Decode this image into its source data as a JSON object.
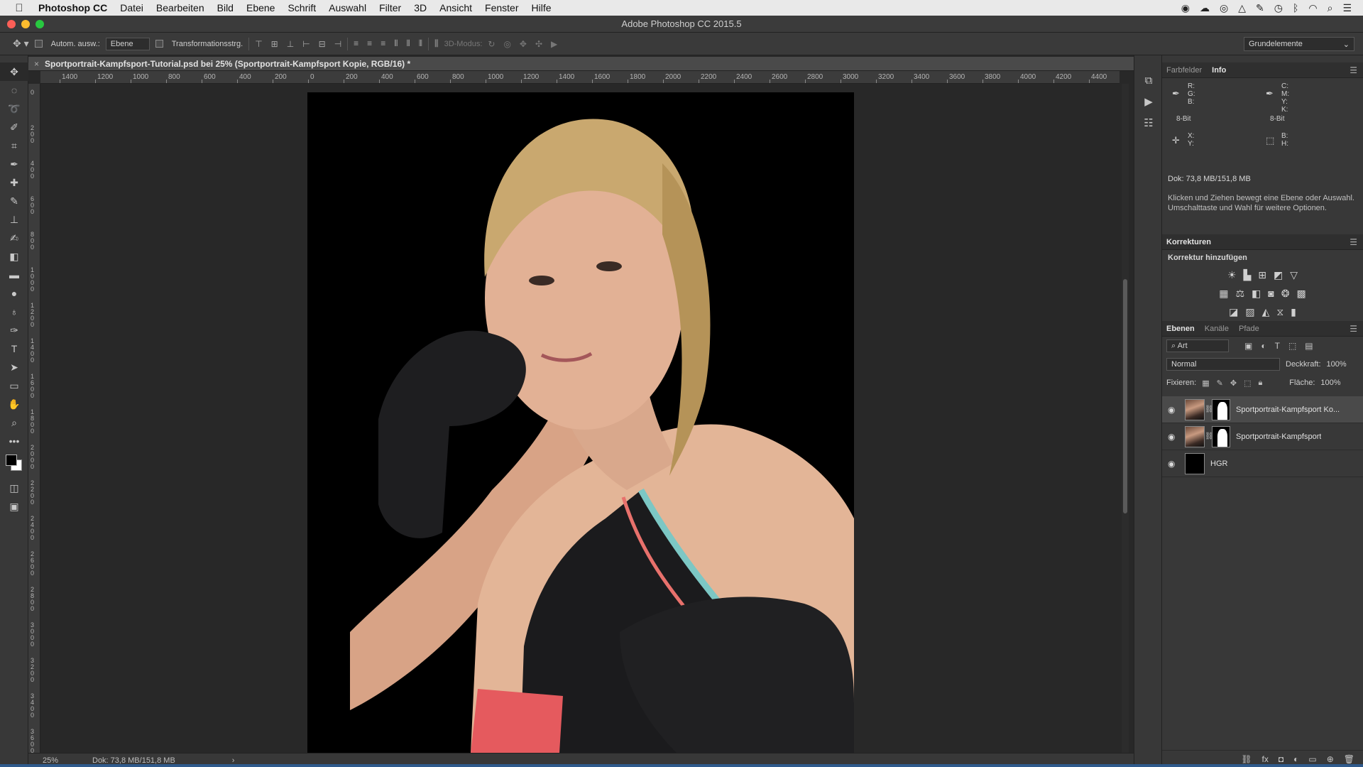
{
  "menubar": {
    "app_name": "Photoshop CC",
    "items": [
      "Datei",
      "Bearbeiten",
      "Bild",
      "Ebene",
      "Schrift",
      "Auswahl",
      "Filter",
      "3D",
      "Ansicht",
      "Fenster",
      "Hilfe"
    ]
  },
  "window": {
    "title": "Adobe Photoshop CC 2015.5"
  },
  "options_bar": {
    "auto_select_label": "Autom. ausw.:",
    "auto_select_target": "Ebene",
    "transform_controls_label": "Transformationsstrg.",
    "mode_3d_label": "3D-Modus:",
    "workspace": "Grundelemente"
  },
  "document": {
    "tab_title": "Sportportrait-Kampfsport-Tutorial.psd bei 25% (Sportportrait-Kampfsport Kopie, RGB/16) *",
    "ruler_h_labels": [
      "1400",
      "1200",
      "1000",
      "800",
      "600",
      "400",
      "200",
      "0",
      "200",
      "400",
      "600",
      "800",
      "1000",
      "1200",
      "1400",
      "1600",
      "1800",
      "2000",
      "2200",
      "2400",
      "2600",
      "2800",
      "3000",
      "3200",
      "3400",
      "3600",
      "3800",
      "4000",
      "4200",
      "4400"
    ],
    "ruler_v_labels": [
      "0",
      "200",
      "400",
      "600",
      "800",
      "1000",
      "1200",
      "1400",
      "1600",
      "1800",
      "2000",
      "2200",
      "2400",
      "2600",
      "2800",
      "3000",
      "3200",
      "3400",
      "3600"
    ]
  },
  "status_bar": {
    "zoom": "25%",
    "doc_size": "Dok: 73,8 MB/151,8 MB",
    "arrow": "›"
  },
  "info_panel": {
    "tabs": [
      "Farbfelder",
      "Info"
    ],
    "active_tab": "Info",
    "rgb_labels": "R:\nG:\nB:",
    "cmyk_labels": "C:\nM:\nY:\nK:",
    "bit_depth_left": "8-Bit",
    "bit_depth_right": "8-Bit",
    "xy_labels": "X:\nY:",
    "bh_labels": "B:\nH:",
    "doc_size": "Dok: 73,8 MB/151,8 MB",
    "hint": "Klicken und Ziehen bewegt eine Ebene oder Auswahl. Umschalttaste und Wahl für weitere Optionen."
  },
  "corrections_panel": {
    "title": "Korrekturen",
    "subtitle": "Korrektur hinzufügen"
  },
  "layers_panel": {
    "tabs": [
      "Ebenen",
      "Kanäle",
      "Pfade"
    ],
    "active_tab": "Ebenen",
    "filter_kind": "Art",
    "blend_mode": "Normal",
    "opacity_label": "Deckkraft:",
    "opacity_value": "100%",
    "lock_label": "Fixieren:",
    "fill_label": "Fläche:",
    "fill_value": "100%",
    "layers": [
      {
        "name": "Sportportrait-Kampfsport Ko...",
        "selected": true
      },
      {
        "name": "Sportportrait-Kampfsport",
        "selected": false
      },
      {
        "name": "HGR",
        "selected": false
      }
    ]
  },
  "colors": {
    "accent_blue": "#2f5a8c",
    "foreground": "#000000",
    "background": "#ffffff"
  }
}
